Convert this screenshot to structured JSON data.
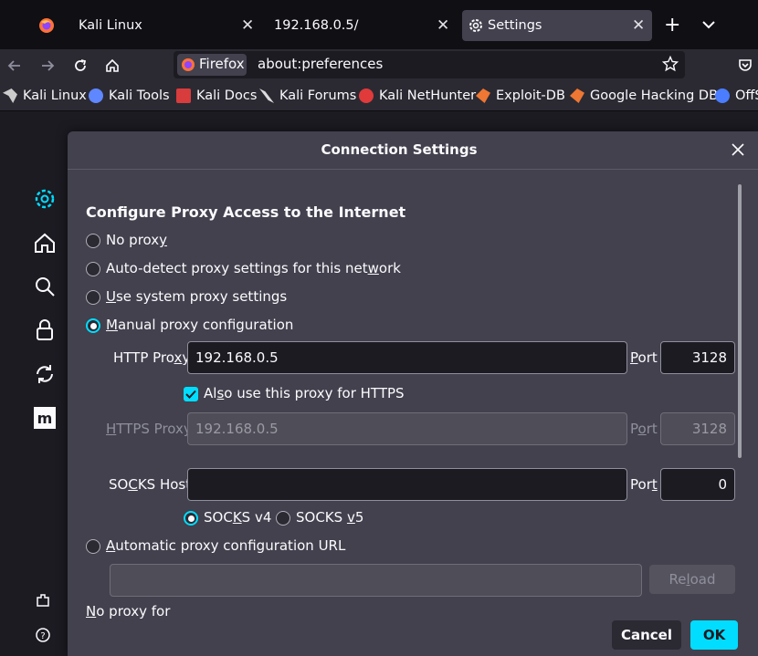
{
  "tabs": [
    {
      "label": "Kali Linux"
    },
    {
      "label": "192.168.0.5/"
    },
    {
      "label": "Settings"
    }
  ],
  "urlbar": {
    "identity": "Firefox",
    "url": "about:preferences"
  },
  "bookmarks": [
    "Kali Linux",
    "Kali Tools",
    "Kali Docs",
    "Kali Forums",
    "Kali NetHunter",
    "Exploit-DB",
    "Google Hacking DB",
    "OffS"
  ],
  "dialog": {
    "title": "Connection Settings",
    "heading": "Configure Proxy Access to the Internet",
    "options": {
      "no_proxy": {
        "pre": "No prox",
        "key": "y",
        "post": ""
      },
      "auto_detect": {
        "pre": "Auto-detect proxy settings for this net",
        "key": "w",
        "post": "ork"
      },
      "system": {
        "pre": "",
        "key": "U",
        "post": "se system proxy settings"
      },
      "manual": {
        "pre": "",
        "key": "M",
        "post": "anual proxy configuration"
      },
      "auto_url": {
        "pre": "",
        "key": "A",
        "post": "utomatic proxy configuration URL"
      }
    },
    "http_proxy": {
      "pre": "HTTP Pro",
      "key": "x",
      "post": "y",
      "value": "192.168.0.5",
      "port": "3128"
    },
    "also_https": {
      "pre": "Al",
      "key": "s",
      "post": "o use this proxy for HTTPS"
    },
    "https_proxy": {
      "pre": "",
      "key": "H",
      "post": "TTPS Proxy",
      "value": "192.168.0.5",
      "port": "3128"
    },
    "socks_host": {
      "pre": "SO",
      "key": "C",
      "post": "KS Host",
      "value": "",
      "port": "0"
    },
    "port_label": {
      "pre": "",
      "key": "P",
      "post": "ort"
    },
    "https_port_label": {
      "pre": "P",
      "key": "o",
      "post": "rt"
    },
    "socks_port_label": {
      "pre": "Por",
      "key": "t",
      "post": ""
    },
    "socks_v4": {
      "pre": "SOC",
      "key": "K",
      "post": "S v4"
    },
    "socks_v5": {
      "pre": "SOCKS ",
      "key": "v",
      "post": "5"
    },
    "reload": {
      "pre": "Re",
      "key": "l",
      "post": "oad"
    },
    "no_proxy_for": {
      "pre": "",
      "key": "N",
      "post": "o proxy for"
    },
    "cancel": "Cancel",
    "ok": "OK"
  },
  "colors": {
    "accent": "#00ddff",
    "dialog_bg": "#42414d",
    "field_bg": "#1c1b22"
  }
}
